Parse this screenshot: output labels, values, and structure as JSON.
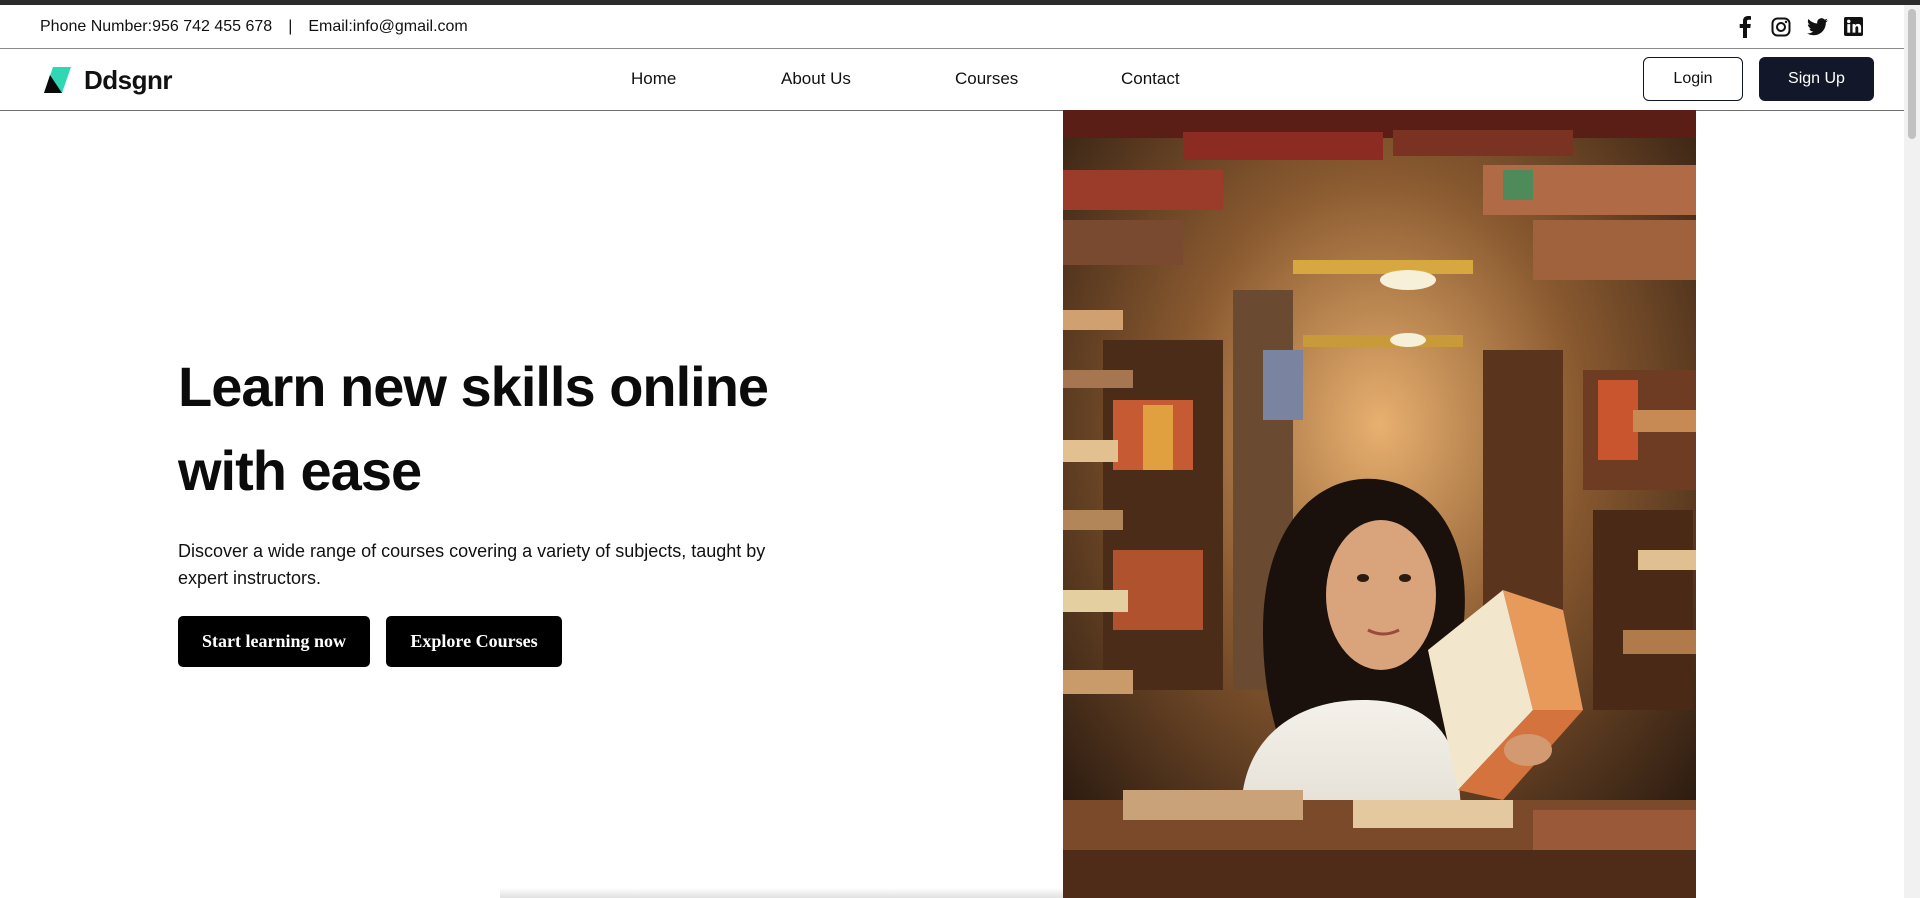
{
  "topbar": {
    "phone": "Phone Number:956 742 455 678",
    "separator": "|",
    "email": "Email:info@gmail.com",
    "socials": [
      "facebook-icon",
      "instagram-icon",
      "twitter-icon",
      "linkedin-icon"
    ]
  },
  "navbar": {
    "brand": "Ddsgnr",
    "links": [
      "Home",
      "About Us",
      "Courses",
      "Contact"
    ],
    "login": "Login",
    "signup": "Sign Up"
  },
  "hero": {
    "title_line1": "Learn new skills online",
    "title_line2": "with ease",
    "description": "Discover a wide range of courses covering a variety of subjects, taught by expert instructors.",
    "primary_button": "Start learning now",
    "secondary_button": "Explore Courses"
  },
  "colors": {
    "brand_accent": "#2fd7b4",
    "dark_button": "#121829",
    "black_button": "#000000"
  }
}
